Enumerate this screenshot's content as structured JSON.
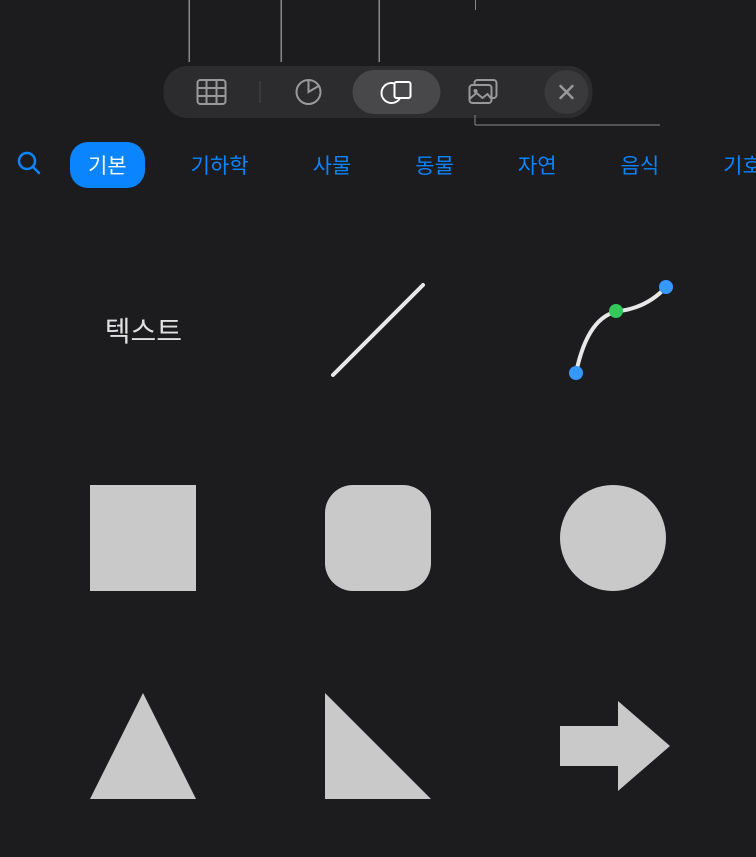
{
  "toolbar": {
    "items": [
      {
        "name": "table",
        "active": false
      },
      {
        "name": "chart",
        "active": false
      },
      {
        "name": "shapes",
        "active": true
      },
      {
        "name": "media",
        "active": false
      }
    ]
  },
  "categories": {
    "items": [
      {
        "label": "기본",
        "active": true
      },
      {
        "label": "기하학",
        "active": false
      },
      {
        "label": "사물",
        "active": false
      },
      {
        "label": "동물",
        "active": false
      },
      {
        "label": "자연",
        "active": false
      },
      {
        "label": "음식",
        "active": false
      },
      {
        "label": "기호",
        "active": false
      }
    ]
  },
  "shapes": {
    "text_label": "텍스트",
    "items": [
      {
        "type": "text",
        "name": "text-shape"
      },
      {
        "type": "line",
        "name": "line-shape"
      },
      {
        "type": "curve",
        "name": "curve-shape"
      },
      {
        "type": "square",
        "name": "square-shape"
      },
      {
        "type": "rounded-square",
        "name": "rounded-square-shape"
      },
      {
        "type": "circle",
        "name": "circle-shape"
      },
      {
        "type": "triangle",
        "name": "triangle-shape"
      },
      {
        "type": "right-triangle",
        "name": "right-triangle-shape"
      },
      {
        "type": "arrow",
        "name": "arrow-right-shape"
      }
    ]
  },
  "colors": {
    "accent": "#0a84ff",
    "shape_fill": "#c9c9c9",
    "curve_handle_blue": "#3498ff",
    "curve_handle_green": "#34c759"
  }
}
